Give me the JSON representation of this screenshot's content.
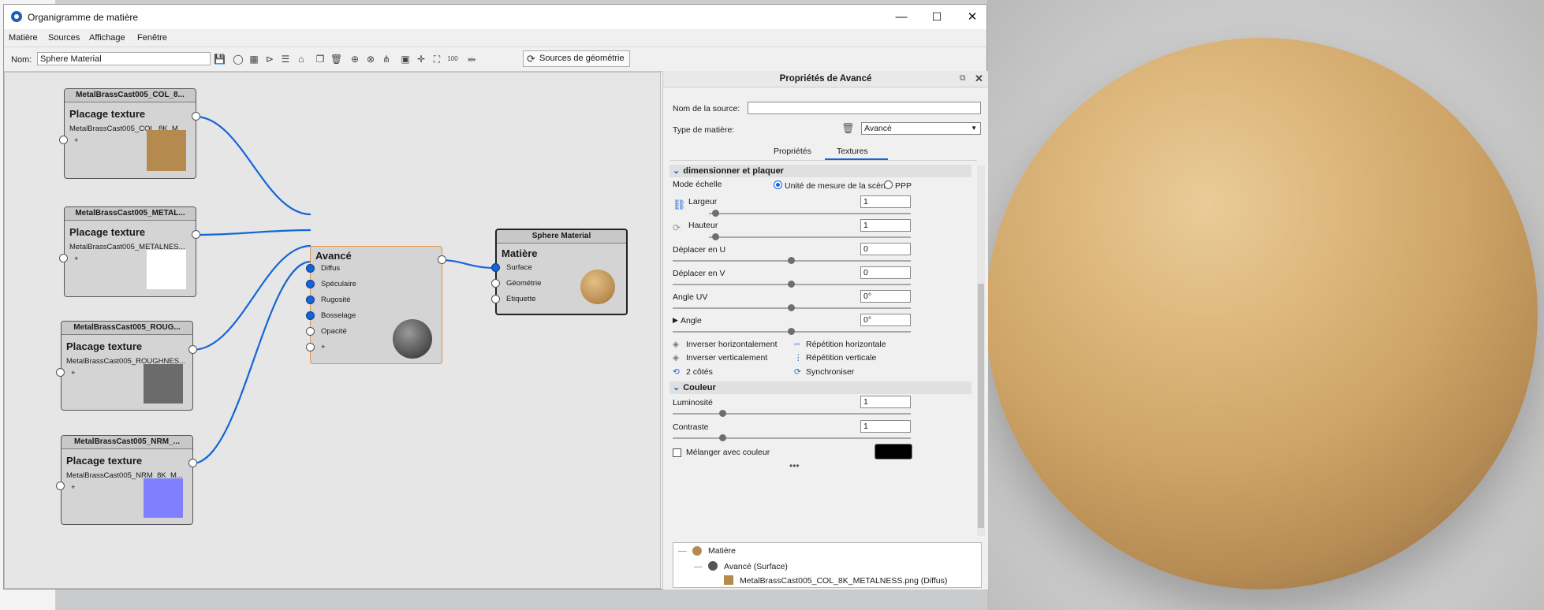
{
  "window": {
    "title": "Organigramme de matière",
    "controls": {
      "minimize": "—",
      "maximize": "☐",
      "close": "✕"
    }
  },
  "menu": [
    "Matière",
    "Sources",
    "Affichage",
    "Fenêtre"
  ],
  "toolbar": {
    "name_label": "Nom:",
    "name_value": "Sphere Material",
    "geometry_button": "Sources de géométrie"
  },
  "graph": {
    "texture_nodes": [
      {
        "header": "MetalBrassCast005_COL_8...",
        "title": "Placage texture",
        "sub": "MetalBrassCast005_COL_8K_M...",
        "plus": "+",
        "thumb_color": "#b58a4e"
      },
      {
        "header": "MetalBrassCast005_METAL...",
        "title": "Placage texture",
        "sub": "MetalBrassCast005_METALNES...",
        "plus": "+",
        "thumb_color": "#ffffff"
      },
      {
        "header": "MetalBrassCast005_ROUG...",
        "title": "Placage texture",
        "sub": "MetalBrassCast005_ROUGHNES...",
        "plus": "+",
        "thumb_color": "#6b6b6b"
      },
      {
        "header": "MetalBrassCast005_NRM_...",
        "title": "Placage texture",
        "sub": "MetalBrassCast005_NRM_8K_M...",
        "plus": "+",
        "thumb_color": "#8080ff"
      }
    ],
    "advanced_node": {
      "title": "Avancé",
      "ports": [
        "Diffus",
        "Spéculaire",
        "Rugosité",
        "Bosselage",
        "Opacité",
        "+"
      ]
    },
    "material_node": {
      "header": "Sphere Material",
      "title": "Matière",
      "ports": [
        "Surface",
        "Géométrie",
        "Etiquette"
      ]
    }
  },
  "props": {
    "title": "Propriétés de Avancé",
    "source_name_label": "Nom de la source:",
    "source_name_value": "",
    "material_type_label": "Type de matière:",
    "material_type_value": "Avancé",
    "tabs": [
      "Propriétés",
      "Textures"
    ],
    "active_tab": "Textures",
    "section_scale": "dimensionner et plaquer",
    "scale_mode_label": "Mode échelle",
    "scale_mode_options": [
      "Unité de mesure de la scène",
      "PPP"
    ],
    "fields": [
      {
        "label": "Largeur",
        "value": "1",
        "level": 0.05
      },
      {
        "label": "Hauteur",
        "value": "1",
        "level": 0.05
      },
      {
        "label": "Déplacer en U",
        "value": "0",
        "level": 0.5
      },
      {
        "label": "Déplacer en V",
        "value": "0",
        "level": 0.5
      },
      {
        "label": "Angle UV",
        "value": "0°",
        "level": 0.5
      },
      {
        "label": "Angle",
        "value": "0°",
        "level": 0.5
      }
    ],
    "options_left": [
      "Inverser horizontalement",
      "Inverser verticalement",
      "2 côtés"
    ],
    "options_right": [
      "Répétition horizontale",
      "Répétition verticale",
      "Synchroniser"
    ],
    "section_color": "Couleur",
    "color_fields": [
      {
        "label": "Luminosité",
        "value": "1",
        "level": 0.2
      },
      {
        "label": "Contraste",
        "value": "1",
        "level": 0.2
      }
    ],
    "blend_label": "Mélanger avec couleur",
    "blend_color": "#000000",
    "more": "•••",
    "tree": [
      "Matière",
      "Avancé (Surface)",
      "MetalBrassCast005_COL_8K_METALNESS.png (Diffus)"
    ]
  }
}
